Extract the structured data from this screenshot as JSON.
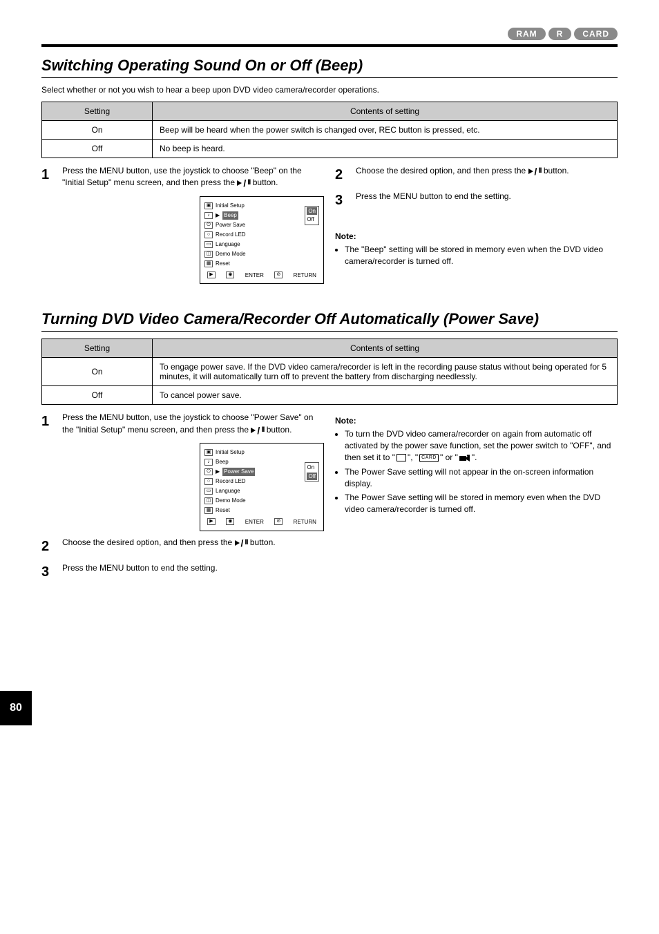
{
  "page_number": "80",
  "badges": {
    "ram": "RAM",
    "r": "R",
    "card": "CARD"
  },
  "beep": {
    "title": "Switching Operating Sound On or Off (Beep)",
    "subtitle": "Select whether or not you wish to hear a beep upon DVD video camera/recorder operations.",
    "table": {
      "col1": "Setting",
      "col2": "Contents of setting",
      "on_label": "On",
      "on_desc": "Beep will be heard when the power switch is changed over, REC button is pressed, etc.",
      "off_label": "Off",
      "No beep is heard.": "off_desc",
      "off_desc": "No beep is heard."
    },
    "step1_num": "1",
    "step1": "Press the MENU button, use the joystick to choose \"Beep\" on the \"Initial Setup\" menu screen, and then press the",
    "step1_cont": "button.",
    "step2_num": "2",
    "step2": "Choose the desired option, and then press the",
    "step2_cont": "button.",
    "step3_num": "3",
    "step3": "Press the MENU button to end the setting.",
    "note_label": "Note:",
    "note_bullet": "The \"Beep\" setting will be stored in memory even when the DVD video camera/recorder is turned off.",
    "diagram": {
      "menu_title": "Initial Setup",
      "items": [
        "Beep",
        "Power Save",
        "Record LED",
        "Language",
        "Demo Mode",
        "Reset"
      ],
      "sub1": "On",
      "sub2": "Off",
      "foot_enter": "ENTER",
      "foot_return": "RETURN"
    }
  },
  "psave": {
    "title": "Turning DVD Video Camera/Recorder Off Automatically (Power Save)",
    "table": {
      "col1": "Setting",
      "col2": "Contents of setting",
      "on_label": "On",
      "on_desc": "To engage power save. If the DVD video camera/recorder is left in the recording pause status without being operated for 5 minutes, it will automatically turn off to prevent the battery from discharging needlessly.",
      "off_label": "Off",
      "off_desc": "To cancel power save."
    },
    "step1_num": "1",
    "step1": "Press the MENU button, use the joystick to choose \"Power Save\" on the \"Initial Setup\" menu screen, and then press the",
    "step1_cont": "button.",
    "step2_num": "2",
    "step2": "Choose the desired option, and then press the",
    "step2_cont": " button.",
    "step3_num": "3",
    "step3": "Press the MENU button to end the setting.",
    "note_label": "Note:",
    "notes": [
      "To turn the DVD video camera/recorder on again from automatic off activated by the power save function, set the power switch to \"OFF\", and then set it to \"",
      "The Power Save setting will not appear in the on-screen information display.",
      "The Power Save setting will be stored in memory even when the DVD video camera/recorder is turned off."
    ],
    "note1_mid": "\", \"",
    "note1_end": "\" or \"",
    "note1_final": "\".",
    "diagram": {
      "menu_title": "Initial Setup",
      "items": [
        "Beep",
        "Power Save",
        "Record LED",
        "Language",
        "Demo Mode",
        "Reset"
      ],
      "sub1": "On",
      "sub2": "Off",
      "foot_enter": "ENTER",
      "foot_return": "RETURN"
    }
  }
}
